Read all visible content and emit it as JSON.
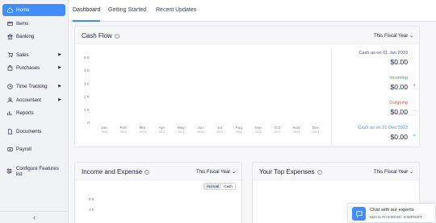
{
  "sidebar": {
    "items": [
      {
        "label": "Home",
        "icon": "home-icon",
        "active": true,
        "has_arrow": false
      },
      {
        "label": "Items",
        "icon": "items-icon",
        "active": false,
        "has_arrow": false
      },
      {
        "label": "Banking",
        "icon": "bank-icon",
        "active": false,
        "has_arrow": false
      },
      {
        "label": "Sales",
        "icon": "cart-icon",
        "active": false,
        "has_arrow": true
      },
      {
        "label": "Purchases",
        "icon": "bag-icon",
        "active": false,
        "has_arrow": true
      },
      {
        "label": "Time Tracking",
        "icon": "clock-icon",
        "active": false,
        "has_arrow": true
      },
      {
        "label": "Accountant",
        "icon": "user-icon",
        "active": false,
        "has_arrow": true
      },
      {
        "label": "Reports",
        "icon": "reports-icon",
        "active": false,
        "has_arrow": false
      },
      {
        "label": "Documents",
        "icon": "documents-icon",
        "active": false,
        "has_arrow": false
      },
      {
        "label": "Payroll",
        "icon": "payroll-icon",
        "active": false,
        "has_arrow": false
      },
      {
        "label": "Configure Features list",
        "icon": "configure-icon",
        "active": false,
        "has_arrow": false
      }
    ],
    "collapse_icon": "chevron-left-icon"
  },
  "tabs": {
    "dashboard": "Dashboard",
    "getting_started": "Getting Started",
    "recent_updates": "Recent Updates"
  },
  "cash_flow": {
    "title": "Cash Flow",
    "period": "This Fiscal Year",
    "start_label": "Cash as on 01 Jan 2023",
    "start_amount": "$0.00",
    "incoming_label": "Incoming",
    "incoming_amount": "$0.00",
    "incoming_sign": "+",
    "outgoing_label": "Outgoing",
    "outgoing_amount": "$0.00",
    "outgoing_sign": "-",
    "end_label": "Cash as on 31 Dec 2023",
    "end_amount": "$0.00",
    "colors": {
      "incoming": "#3fa34d",
      "outgoing": "#e2504c",
      "end": "#408dfb"
    }
  },
  "income_expense": {
    "title": "Income and Expense",
    "period": "This Fiscal Year",
    "toggle_accrual": "Accrual",
    "toggle_cash": "Cash"
  },
  "top_expenses": {
    "title": "Your Top Expenses",
    "period": "This Fiscal Year"
  },
  "chat": {
    "title": "Chat with our experts",
    "hours": "Mon to Fri 9:00AM - 9:00PM ET"
  },
  "chart_data": [
    {
      "type": "line",
      "title": "Cash Flow",
      "categories": [
        "Jan 2023",
        "Feb 2023",
        "Mar 2023",
        "Apr 2023",
        "May 2023",
        "Jun 2023",
        "Jul 2023",
        "Aug 2023",
        "Sep 2023",
        "Oct 2023",
        "Nov 2023",
        "Dec 2023"
      ],
      "month_labels": [
        "Jan",
        "Feb",
        "Mar",
        "Apr",
        "May",
        "Jun",
        "Jul",
        "Aug",
        "Sep",
        "Oct",
        "Nov",
        "Dec"
      ],
      "year_label": "2023",
      "ytick_labels": [
        "5 K",
        "4 K",
        "3 K",
        "2 K",
        "1 K",
        "0"
      ],
      "ylim": [
        0,
        5000
      ],
      "values": [
        0,
        0,
        0,
        0,
        0,
        0,
        0,
        0,
        0,
        0,
        0,
        0
      ],
      "grid": false
    },
    {
      "type": "bar",
      "title": "Income and Expense",
      "ytick_labels": [
        "5 K",
        "4 K"
      ],
      "ylim": [
        0,
        5000
      ]
    }
  ],
  "accent_color": "#408dfb"
}
